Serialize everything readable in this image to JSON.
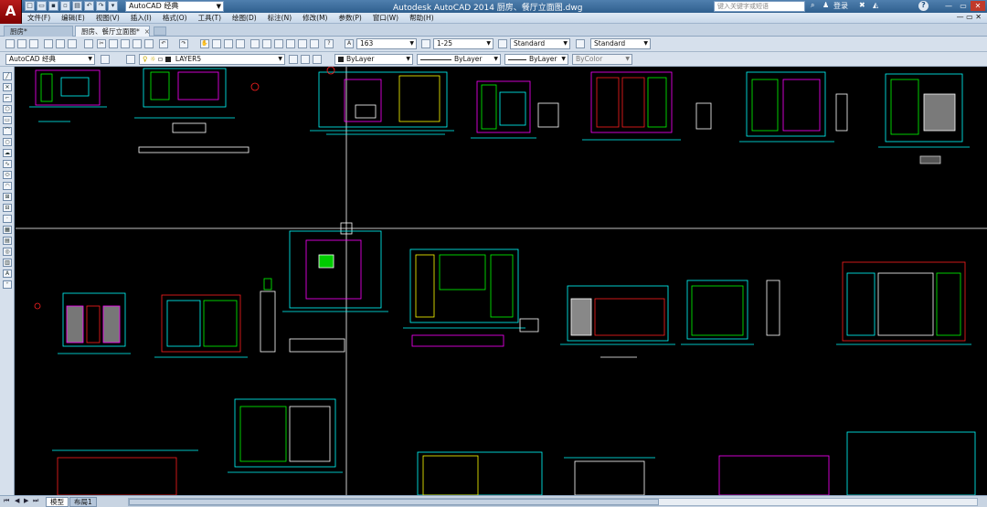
{
  "app": {
    "logo": "A",
    "title": "Autodesk AutoCAD 2014   厨房、餐厅立面图.dwg",
    "workspace": "AutoCAD 经典",
    "search_placeholder": "键入关键字或短语",
    "login": "登录"
  },
  "menu": [
    "文件(F)",
    "编辑(E)",
    "视图(V)",
    "插入(I)",
    "格式(O)",
    "工具(T)",
    "绘图(D)",
    "标注(N)",
    "修改(M)",
    "参数(P)",
    "窗口(W)",
    "帮助(H)"
  ],
  "tabs": [
    {
      "label": "厨房*"
    },
    {
      "label": "厨房、餐厅立面图*",
      "active": true
    }
  ],
  "toolbar1": {
    "text_height": "163",
    "dim_scale": "1-25",
    "text_style": "Standard",
    "table_style": "Standard"
  },
  "toolbar2": {
    "workspace": "AutoCAD 经典",
    "layer": "LAYER5",
    "color": "ByLayer",
    "linetype": "ByLayer",
    "lineweight": "ByLayer",
    "plot_style": "ByColor"
  },
  "layout_tabs": [
    "模型",
    "布局1"
  ],
  "colors": {
    "titlebar": "#2f5f8e",
    "canvas": "#000000",
    "cyan": "#00ffff",
    "magenta": "#ff00ff",
    "green": "#00ff00",
    "white": "#ffffff",
    "red": "#ff2020"
  }
}
